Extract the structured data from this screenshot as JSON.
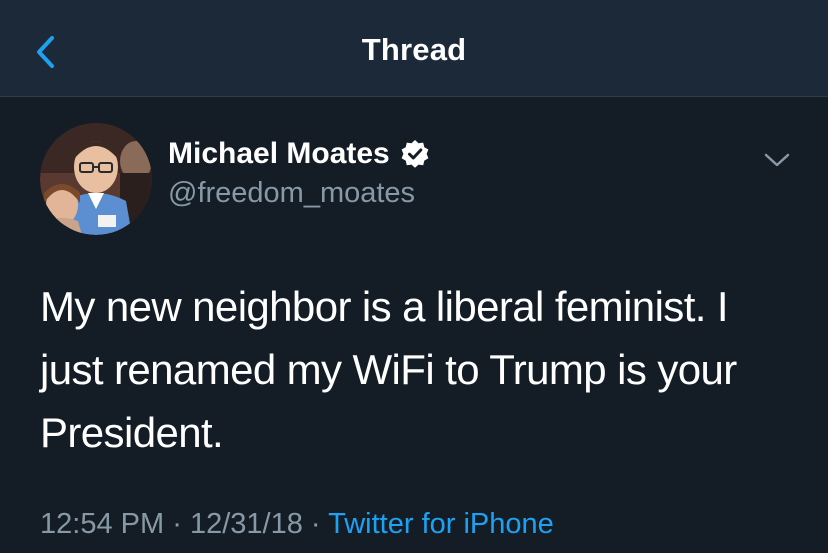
{
  "nav": {
    "title": "Thread",
    "back_icon": "chevron-left-icon"
  },
  "tweet": {
    "author_name": "Michael Moates",
    "handle": "@freedom_moates",
    "verified_icon": "verified-badge-icon",
    "menu_icon": "chevron-down-icon",
    "text": "My new neighbor is a liberal feminist. I just renamed my WiFi to Trump is your President.",
    "time": "12:54 PM",
    "separator": "·",
    "date": "12/31/18",
    "source": "Twitter for iPhone"
  },
  "colors": {
    "background": "#141d26",
    "navbar": "#1c2938",
    "secondary_text": "#8899a6",
    "accent": "#1da1f2"
  }
}
